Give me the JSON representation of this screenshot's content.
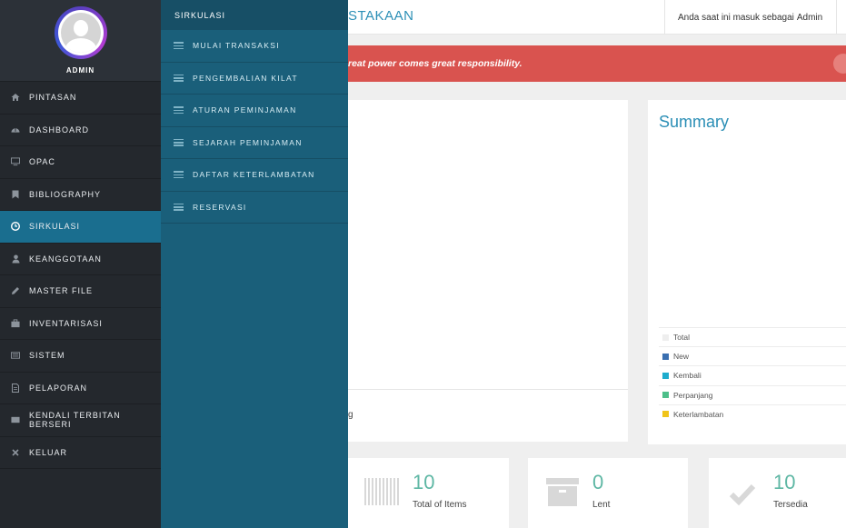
{
  "profile": {
    "name": "ADMIN"
  },
  "sidebar": {
    "items": [
      {
        "label": "PINTASAN"
      },
      {
        "label": "DASHBOARD"
      },
      {
        "label": "OPAC"
      },
      {
        "label": "BIBLIOGRAPHY"
      },
      {
        "label": "SIRKULASI"
      },
      {
        "label": "KEANGGOTAAN"
      },
      {
        "label": "MASTER FILE"
      },
      {
        "label": "INVENTARISASI"
      },
      {
        "label": "SISTEM"
      },
      {
        "label": "PELAPORAN"
      },
      {
        "label": "KENDALI TERBITAN BERSERI"
      },
      {
        "label": "KELUAR"
      }
    ]
  },
  "submenu": {
    "title": "SIRKULASI",
    "items": [
      {
        "label": "MULAI TRANSAKSI"
      },
      {
        "label": "PENGEMBALIAN KILAT"
      },
      {
        "label": "ATURAN PEMINJAMAN"
      },
      {
        "label": "SEJARAH PEMINJAMAN"
      },
      {
        "label": "DAFTAR KETERLAMBATAN"
      },
      {
        "label": "RESERVASI"
      }
    ]
  },
  "header": {
    "title": "STAKAAN",
    "user_prefix": "Anda saat ini masuk sebagai",
    "user_name": "Admin"
  },
  "alert": {
    "text": "reat power comes great responsibility."
  },
  "panel_left": {
    "trailing_text": "g"
  },
  "summary": {
    "title": "Summary",
    "legend": [
      {
        "label": "Total",
        "color": "#eeeeee"
      },
      {
        "label": "New",
        "color": "#3a6fb0"
      },
      {
        "label": "Kembali",
        "color": "#1eaccd"
      },
      {
        "label": "Perpanjang",
        "color": "#4dbf8a"
      },
      {
        "label": "Keterlambatan",
        "color": "#f0c419"
      }
    ]
  },
  "stats": [
    {
      "value": "10",
      "label": "Total of Items",
      "icon": "barcode-icon"
    },
    {
      "value": "0",
      "label": "Lent",
      "icon": "archive-box-icon"
    },
    {
      "value": "10",
      "label": "Tersedia",
      "icon": "check-icon"
    }
  ],
  "colors": {
    "sidebar_bg": "#24282d",
    "active_bg": "#1a6e8f",
    "submenu_bg": "#1a5f7a",
    "alert_bg": "#d9534f",
    "accent": "#2c8fb6",
    "stat_number": "#5eb7a4"
  }
}
